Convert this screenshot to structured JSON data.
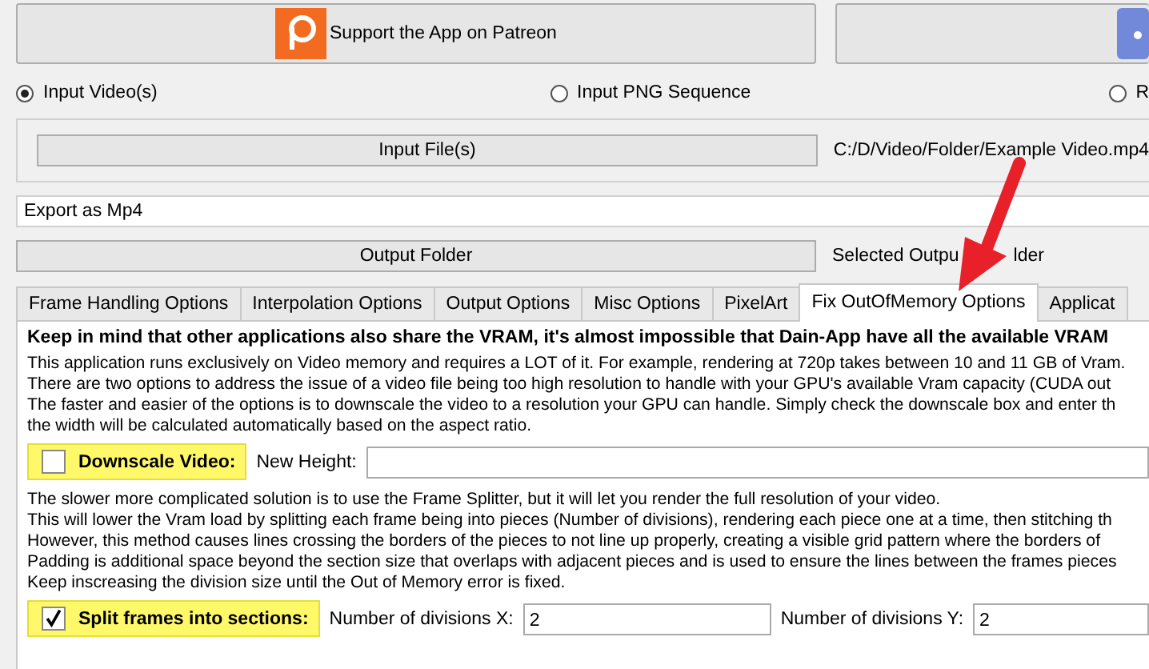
{
  "top_buttons": [
    {
      "label": "Support the App on Patreon",
      "kind": "patreon"
    },
    {
      "kind": "discord"
    }
  ],
  "input_modes": [
    {
      "label": "Input Video(s)",
      "selected": true
    },
    {
      "label": "Input PNG Sequence",
      "selected": false
    },
    {
      "label": "R",
      "selected": false
    }
  ],
  "input_file": {
    "button": "Input File(s)",
    "path": "C:/D/Video/Folder/Example Video.mp4"
  },
  "export_format": {
    "value": "Export as Mp4"
  },
  "output": {
    "button": "Output Folder",
    "path_parts": [
      "Selected Outpu",
      "lder"
    ]
  },
  "tabs": [
    {
      "label": "Frame Handling Options",
      "selected": false
    },
    {
      "label": "Interpolation Options",
      "selected": false
    },
    {
      "label": "Output Options",
      "selected": false
    },
    {
      "label": "Misc Options",
      "selected": false
    },
    {
      "label": "PixelArt",
      "selected": false
    },
    {
      "label": "Fix OutOfMemory Options",
      "selected": true
    },
    {
      "label": "Applicat",
      "selected": false
    }
  ],
  "warning": "Keep in mind that other applications also share the VRAM, it's almost impossible that Dain-App have all the available VRAM",
  "downscale_text": [
    "This application runs exclusively on Video memory and requires a LOT of it. For example, rendering at 720p takes between 10 and 11 GB of Vram.",
    "There are two options to address the issue of a video file being too high resolution to handle with your GPU's available Vram capacity (CUDA out",
    "The faster and easier of the options is to downscale the video to a resolution your GPU can handle. Simply check the downscale box and enter th",
    "the width will be calculated automatically based on the aspect ratio."
  ],
  "downscale": {
    "label": "Downscale Video:",
    "checked": false,
    "height_label": "New Height:"
  },
  "split_text": [
    "The slower more complicated solution is to use the Frame Splitter, but it will let you render the full resolution of your video.",
    "This will lower the Vram load by splitting each frame being into pieces (Number of divisions), rendering each piece one at a time, then stitching th",
    "However, this method causes lines crossing the borders of the pieces to not line up properly, creating  a visible grid pattern where the borders of",
    "Padding is additional space beyond the section size that overlaps with adjacent pieces and is used to ensure the lines between the frames pieces",
    "Keep inscreasing the division size until the Out of Memory error is fixed."
  ],
  "split": {
    "label": "Split frames into sections:",
    "checked": true,
    "x_label": "Number of divisions X:",
    "x_value": "2",
    "y_label": "Number of divisions Y:",
    "y_value": "2"
  }
}
